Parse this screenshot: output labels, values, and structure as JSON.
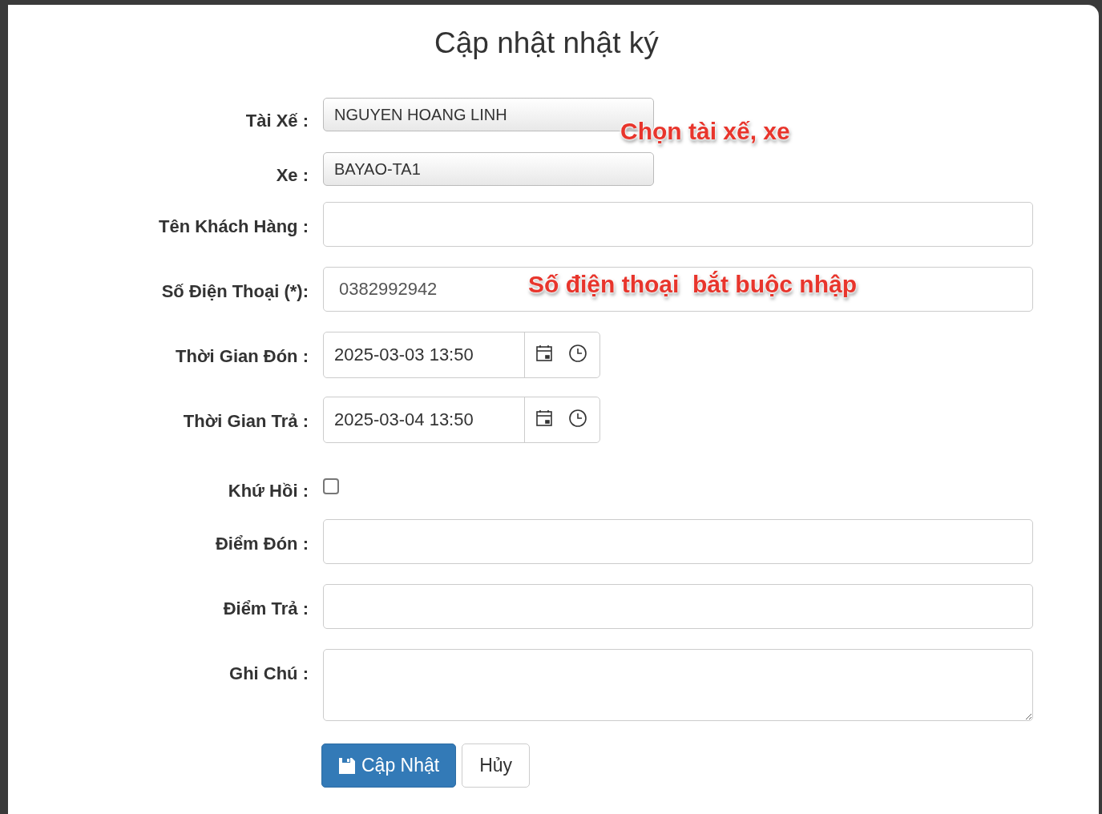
{
  "dialog": {
    "title": "Cập nhật nhật ký"
  },
  "fields": [
    {
      "kind": "select",
      "label": "Tài Xế :",
      "value": "NGUYEN HOANG LINH",
      "annotation": "Chọn tài xế, xe"
    },
    {
      "kind": "select",
      "label": "Xe :",
      "value": "BAYAO-TA1"
    },
    {
      "kind": "text",
      "label": "Tên Khách Hàng :"
    },
    {
      "kind": "text",
      "label": "Số Điện Thoại (*):",
      "value": "0382992942",
      "annotation": "Số điện thoại  bắt buộc nhập"
    },
    {
      "kind": "datetime",
      "label": "Thời Gian Đón :",
      "value": "2025-03-03 13:50"
    },
    {
      "kind": "datetime",
      "label": "Thời Gian Trả :",
      "value": "2025-03-04 13:50"
    },
    {
      "kind": "checkbox",
      "label": "Khứ Hồi :",
      "checked": false
    },
    {
      "kind": "text",
      "label": "Điểm Đón :"
    },
    {
      "kind": "text",
      "label": "Điểm Trả :"
    },
    {
      "kind": "textarea",
      "label": "Ghi Chú :"
    }
  ],
  "buttons": [
    {
      "kind": "primary",
      "label": "Cập Nhật"
    },
    {
      "kind": "default",
      "label": "Hủy"
    }
  ]
}
